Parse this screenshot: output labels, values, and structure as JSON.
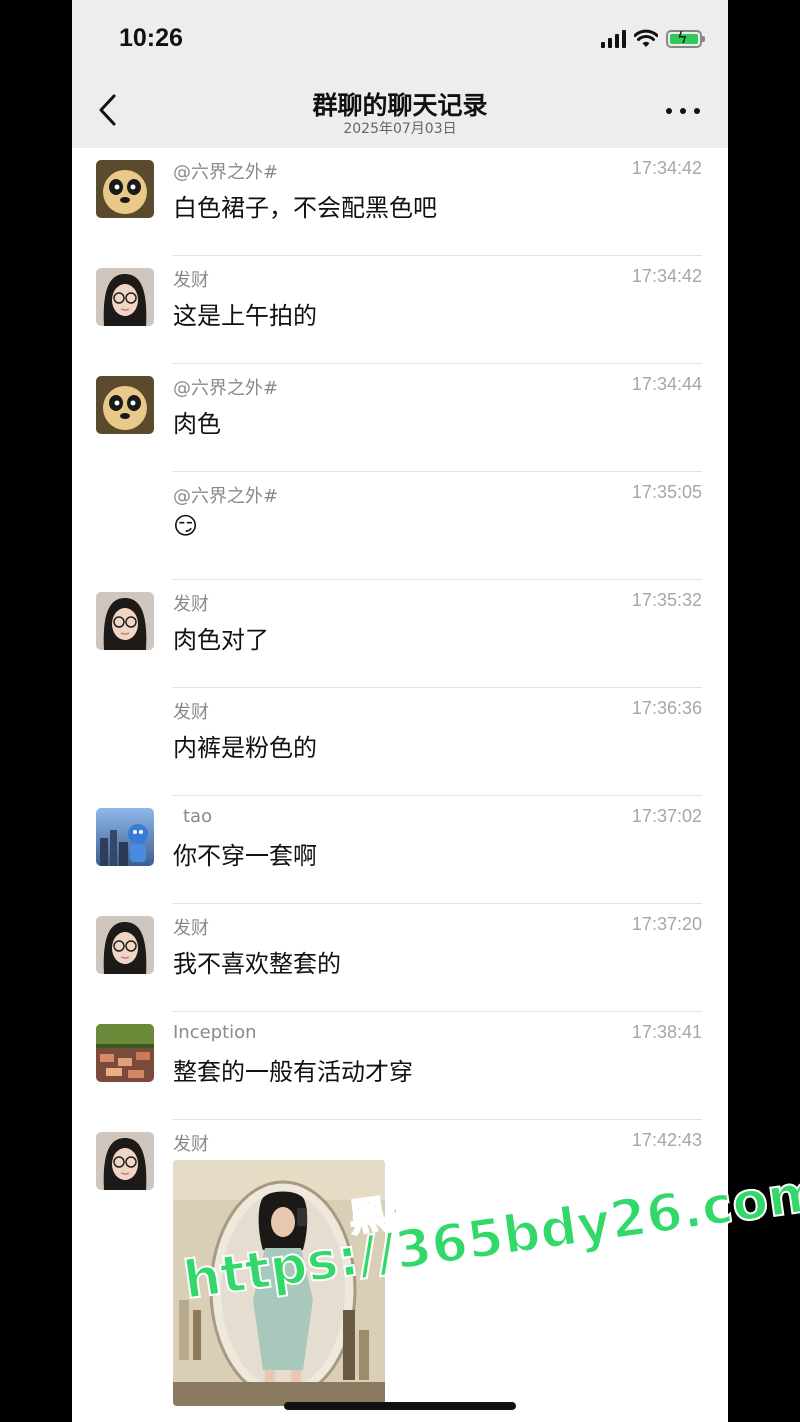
{
  "status_bar": {
    "time": "10:26"
  },
  "header": {
    "title": "群聊的聊天记录",
    "subtitle": "2025年07月03日"
  },
  "messages": [
    {
      "sender": "@六界之外#",
      "time": "17:34:42",
      "text": "白色裙子，不会配黑色吧",
      "avatar": "panda"
    },
    {
      "sender": "发财",
      "time": "17:34:42",
      "text": "这是上午拍的",
      "avatar": "girl"
    },
    {
      "sender": "@六界之外#",
      "time": "17:34:44",
      "text": "肉色",
      "avatar": "panda"
    },
    {
      "sender": "@六界之外#",
      "time": "17:35:05",
      "text": "😏",
      "avatar": "none"
    },
    {
      "sender": "发财",
      "time": "17:35:32",
      "text": "肉色对了",
      "avatar": "girl"
    },
    {
      "sender": "发财",
      "time": "17:36:36",
      "text": "内裤是粉色的",
      "avatar": "none"
    },
    {
      "sender": "tao",
      "time": "17:37:02",
      "text": "你不穿一套啊",
      "avatar": "city"
    },
    {
      "sender": "发财",
      "time": "17:37:20",
      "text": "我不喜欢整套的",
      "avatar": "girl"
    },
    {
      "sender": "Inception",
      "time": "17:38:41",
      "text": "整套的一般有活动才穿",
      "avatar": "landscape"
    },
    {
      "sender": "发财",
      "time": "17:42:43",
      "text": "",
      "avatar": "girl"
    }
  ],
  "watermark": {
    "line1": "黑料不打烊",
    "line2": "https://365bdy26.com"
  },
  "colors": {
    "top_bar_bg": "#ededed",
    "watermark_green": "#32d96a",
    "battery_green": "#34c759"
  }
}
